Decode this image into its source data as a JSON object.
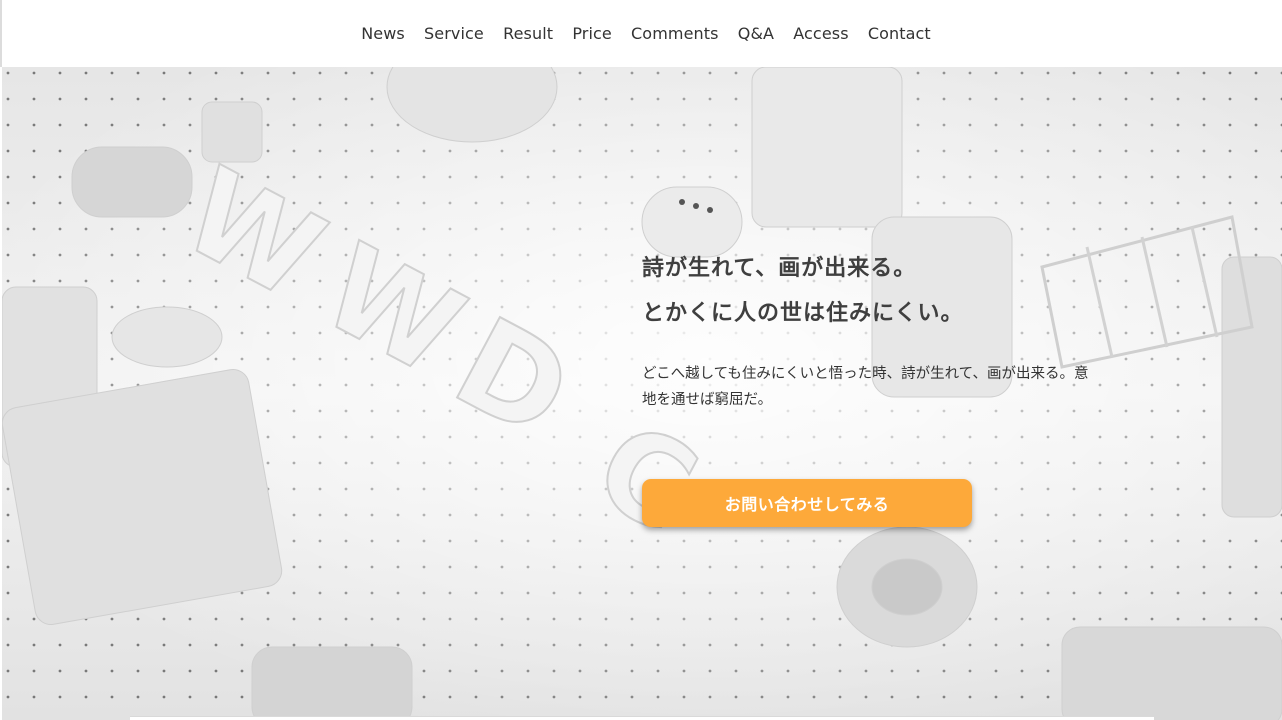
{
  "nav": {
    "items": [
      {
        "label": "News"
      },
      {
        "label": "Service"
      },
      {
        "label": "Result"
      },
      {
        "label": "Price"
      },
      {
        "label": "Comments"
      },
      {
        "label": "Q&A"
      },
      {
        "label": "Access"
      },
      {
        "label": "Contact"
      }
    ]
  },
  "hero": {
    "headline_line1": "詩が生れて、画が出来る。",
    "headline_line2": "とかくに人の世は住みにくい。",
    "lead": "どこへ越しても住みにくいと悟った時、詩が生れて、画が出来る。意地を通せば窮屈だ。",
    "cta_label": "お問い合わせしてみる",
    "background_image": "wwdc-18-3d-letters",
    "cta_color": "#fda93a"
  }
}
